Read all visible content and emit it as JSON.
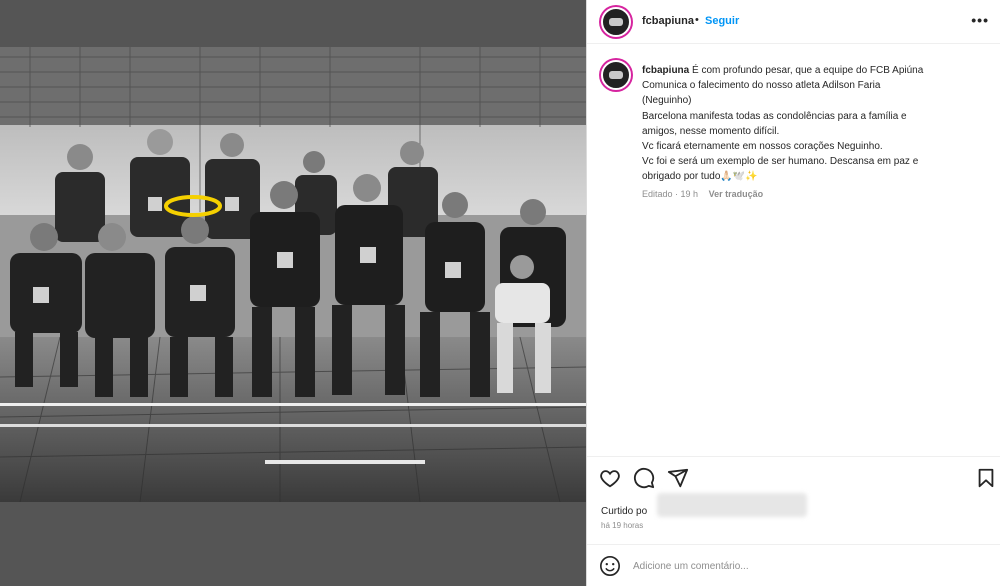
{
  "post": {
    "username": "fcbapiuna",
    "follow_label": "Seguir",
    "more_label": "•••"
  },
  "caption": {
    "username": "fcbapiuna",
    "lines": [
      "É com profundo pesar, que a equipe do FCB Apiúna",
      "Comunica o falecimento do nosso atleta Adilson Faria",
      "(Neguinho)",
      "Barcelona manifesta todas as condolências para a família e",
      "amigos, nesse momento difícil.",
      "Vc ficará eternamente em nossos corações Neguinho.",
      "Vc foi e será um exemplo de ser humano. Descansa em paz e",
      "obrigado por tudo🙏🏻🕊️✨"
    ],
    "edited_label": "Editado",
    "age": "19 h",
    "translate_label": "Ver tradução"
  },
  "actions": {
    "icons": [
      "heart-icon",
      "comment-icon",
      "share-icon",
      "bookmark-icon"
    ],
    "likes_prefix": "Curtido po",
    "timestamp": "há 19 horas"
  },
  "comment": {
    "placeholder": "Adicione um comentário...",
    "post_label": ""
  },
  "colors": {
    "accent": "#0095f6",
    "text": "#262626",
    "muted": "#8e8e8e",
    "halo": "#f5d000"
  }
}
